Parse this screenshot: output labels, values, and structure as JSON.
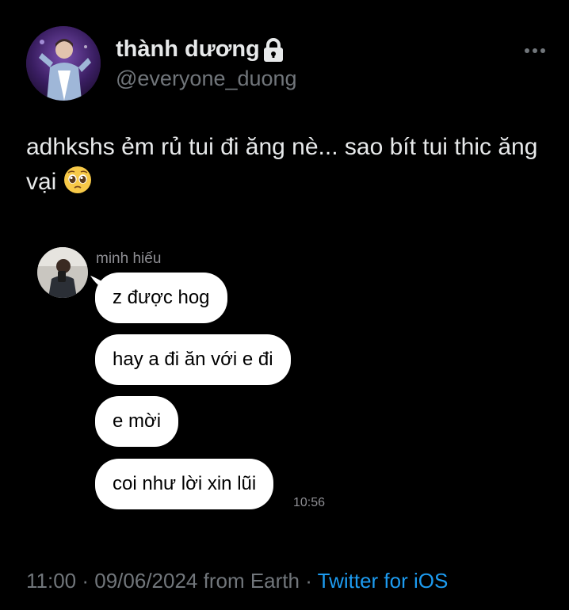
{
  "author": {
    "name": "thành dương",
    "handle": "@everyone_duong",
    "protected_icon": "lock-icon",
    "menu_icon": "more-horizontal-icon"
  },
  "tweet": {
    "text": "adhkshs ẻm rủ tui đi ăng nè... sao bít tui thic ăng vại",
    "emoji": "pleading-face-emoji"
  },
  "chat": {
    "sender": "minh hiếu",
    "messages": [
      "z được hog",
      "hay a đi ăn với e đi",
      "e mời",
      "coi như lời xin lũi"
    ],
    "time": "10:56"
  },
  "meta": {
    "time": "11:00",
    "separator1": " · ",
    "date": "09/06/2024",
    "location": " from Earth",
    "separator2": " · ",
    "source": "Twitter for iOS"
  },
  "colors": {
    "background": "#000000",
    "text": "#e7e9ea",
    "secondary": "#71767b",
    "link": "#1d9bf0",
    "bubble": "#ffffff"
  }
}
